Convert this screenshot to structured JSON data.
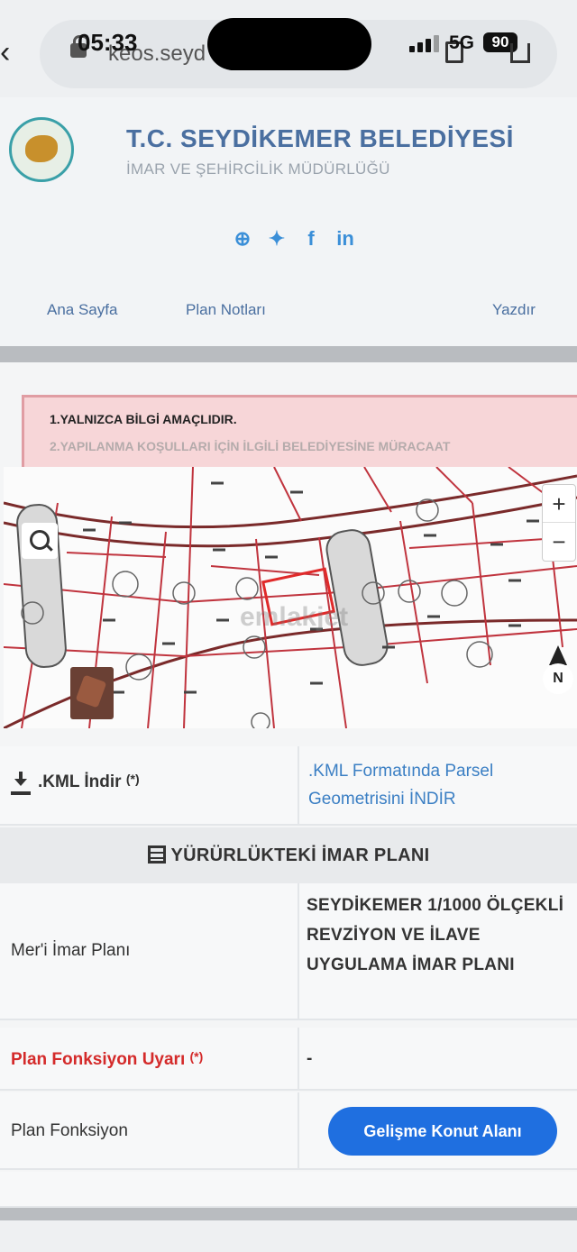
{
  "status_bar": {
    "time": "05:33",
    "network": "5G",
    "battery": "90"
  },
  "browser": {
    "url": "keos.seyd"
  },
  "header": {
    "title": "T.C. SEYDİKEMER BELEDİYESİ",
    "subtitle": "İMAR VE ŞEHİRCİLİK MÜDÜRLÜĞÜ",
    "social": [
      "globe-icon",
      "twitter-icon",
      "facebook-icon",
      "linkedin-icon"
    ]
  },
  "nav": {
    "home": "Ana Sayfa",
    "plan_notes": "Plan Notları",
    "print": "Yazdır"
  },
  "warning": {
    "line1": "1.YALNIZCA BİLGİ AMAÇLIDIR.",
    "line2": "2.YAPILANMA KOŞULLARI İÇİN İLGİLİ BELEDİYESİNE MÜRACAAT"
  },
  "map": {
    "zoom_in": "+",
    "zoom_out": "−",
    "north": "N",
    "watermark": "emlakjet"
  },
  "kml": {
    "label": ".KML İndir",
    "label_note": "(*)",
    "link": ".KML Formatında Parsel Geometrisini İNDİR"
  },
  "section": {
    "title": "YÜRÜRLÜKTEKİ İMAR PLANI"
  },
  "rows": [
    {
      "label": "Mer'i İmar Planı",
      "value": "SEYDİKEMER 1/1000 ÖLÇEKLİ REVZİYON VE İLAVE UYGULAMA İMAR PLANI"
    },
    {
      "label": "Plan Fonksiyon Uyarı",
      "label_note": "(*)",
      "value": "-"
    },
    {
      "label": "Plan Fonksiyon",
      "value": "Gelişme Konut Alanı"
    }
  ],
  "colors": {
    "accent": "#1f6fe0",
    "title": "#4a6fa0",
    "warning_bg": "#f7d6d8",
    "parcel_line": "#c0343e"
  }
}
